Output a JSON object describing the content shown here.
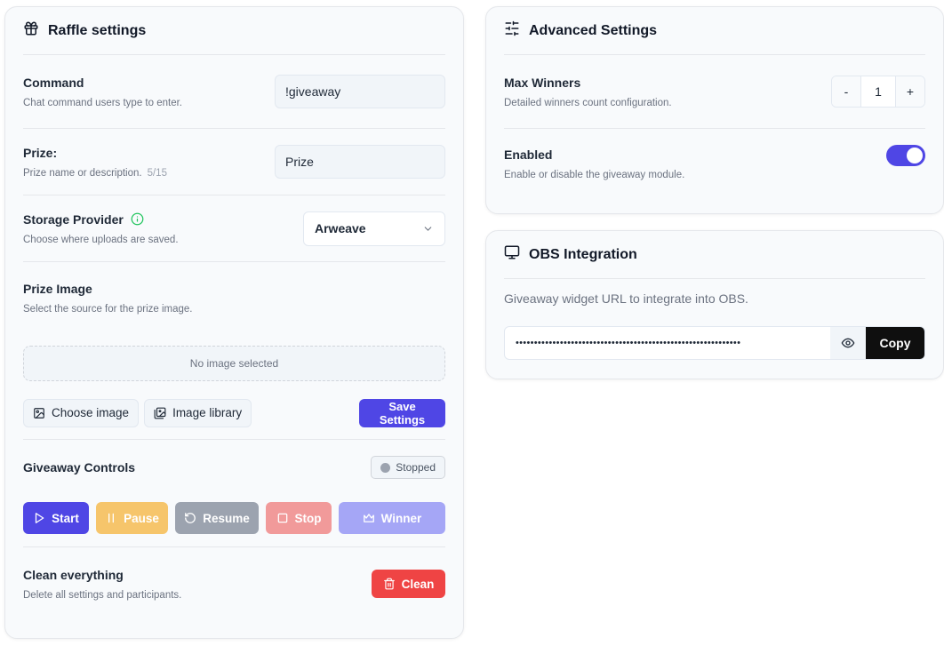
{
  "raffle": {
    "title": "Raffle settings",
    "command": {
      "label": "Command",
      "help": "Chat command users type to enter.",
      "value": "!giveaway"
    },
    "prize": {
      "label": "Prize:",
      "help": "Prize name or description.",
      "counter": "5/15",
      "value": "Prize"
    },
    "storage": {
      "label": "Storage Provider",
      "help": "Choose where uploads are saved.",
      "value": "Arweave"
    },
    "prize_image": {
      "label": "Prize Image",
      "help": "Select the source for the prize image.",
      "empty": "No image selected",
      "choose_label": "Choose image",
      "library_label": "Image library"
    },
    "save_label": "Save Settings",
    "controls": {
      "label": "Giveaway Controls",
      "status": "Stopped",
      "start": "Start",
      "pause": "Pause",
      "resume": "Resume",
      "stop": "Stop",
      "winner": "Winner"
    },
    "clean": {
      "label": "Clean everything",
      "help": "Delete all settings and participants.",
      "button": "Clean"
    }
  },
  "advanced": {
    "title": "Advanced Settings",
    "max_winners": {
      "label": "Max Winners",
      "help": "Detailed winners count configuration.",
      "value": "1",
      "minus": "-",
      "plus": "+"
    },
    "enabled": {
      "label": "Enabled",
      "help": "Enable or disable the giveaway module.",
      "on": true
    }
  },
  "obs": {
    "title": "OBS Integration",
    "description": "Giveaway widget URL to integrate into OBS.",
    "masked_url": "•••••••••••••••••••••••••••••••••••••••••••••••••••••••••••••",
    "copy_label": "Copy"
  },
  "colors": {
    "primary": "#4f46e5",
    "start": "#4f46e5",
    "pause": "#f6c56b",
    "resume": "#9ca3af",
    "stop": "#f19a9a",
    "winner": "#a5a6f6",
    "clean": "#ef4444",
    "info": "#22c55e"
  }
}
